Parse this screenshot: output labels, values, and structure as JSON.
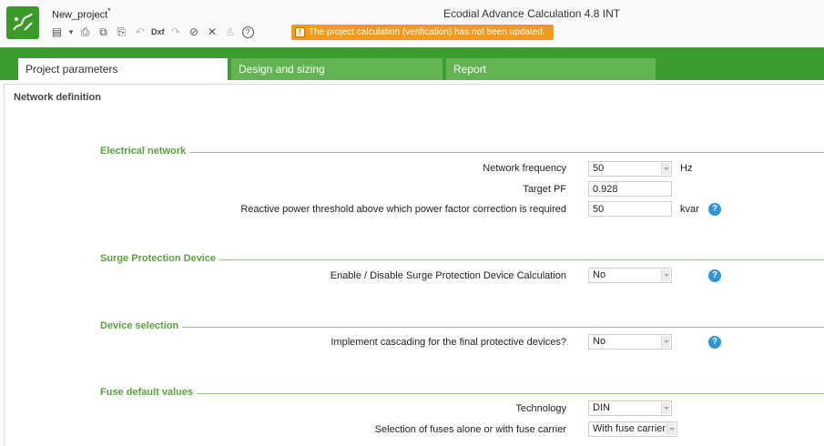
{
  "app": {
    "project_name": "New_project",
    "modified_marker": "*",
    "title": "Ecodial Advance Calculation 4.8 INT",
    "logo_icon": "ecodial-logo-icon",
    "accent_color": "#3d9c30"
  },
  "toolbar": {
    "items": [
      {
        "icon": "save-icon",
        "glyph": "▤"
      },
      {
        "icon": "dropdown-arrow-icon",
        "glyph": "▾"
      },
      {
        "icon": "print-icon",
        "glyph": "⎙"
      },
      {
        "icon": "copy-icon",
        "glyph": "⧉"
      },
      {
        "icon": "paste-icon",
        "glyph": "⎘"
      },
      {
        "icon": "undo-icon",
        "glyph": "↶"
      },
      {
        "icon": "dxf-export-icon",
        "text": "Dxf"
      },
      {
        "icon": "redo-icon",
        "glyph": "↷"
      },
      {
        "icon": "file-icon",
        "glyph": "🗋"
      },
      {
        "icon": "tools-icon",
        "glyph": "✕"
      },
      {
        "icon": "user-icon",
        "glyph": "♙"
      },
      {
        "icon": "help-icon",
        "glyph": "?"
      }
    ],
    "warning": "The project calculation (verification) has not been updated.",
    "warning_color": "#f39a1b"
  },
  "tabs": [
    {
      "label": "Project parameters",
      "active": true
    },
    {
      "label": "Design and sizing",
      "active": false
    },
    {
      "label": "Report",
      "active": false
    }
  ],
  "main": {
    "section_title": "Network definition",
    "groups": {
      "electrical": {
        "title": "Electrical network",
        "frequency_label": "Network frequency",
        "frequency_value": "50",
        "frequency_unit": "Hz",
        "target_pf_label": "Target PF",
        "target_pf_value": "0.928",
        "reactive_label": "Reactive power threshold above which power factor correction is required",
        "reactive_value": "50",
        "reactive_unit": "kvar"
      },
      "spd": {
        "title": "Surge Protection Device",
        "enable_label": "Enable / Disable Surge Protection Device Calculation",
        "enable_value": "No"
      },
      "device": {
        "title": "Device selection",
        "cascading_label": "Implement cascading for the final protective devices?",
        "cascading_value": "No"
      },
      "fuse": {
        "title": "Fuse default values",
        "technology_label": "Technology",
        "technology_value": "DIN",
        "carrier_label": "Selection of fuses alone or with fuse carrier",
        "carrier_value": "With fuse carrier"
      }
    }
  }
}
